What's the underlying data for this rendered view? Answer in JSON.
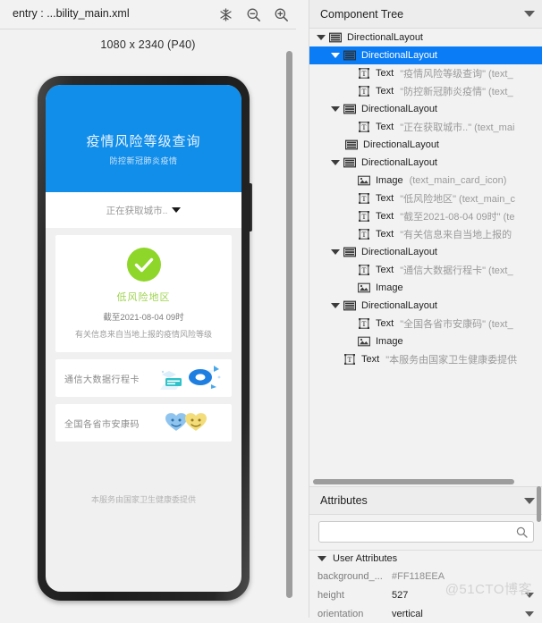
{
  "toolbar": {
    "title": "entry : ...bility_main.xml",
    "icons": [
      {
        "name": "snowflake-icon"
      },
      {
        "name": "zoom-out-icon"
      },
      {
        "name": "zoom-in-icon"
      }
    ]
  },
  "canvas": {
    "device_label": "1080 x 2340 (P40)"
  },
  "preview": {
    "header_title": "疫情风险等级查询",
    "header_subtitle": "防控新冠肺炎疫情",
    "city_selector": "正在获取城市..",
    "risk_level": "低风险地区",
    "risk_time": "截至2021-08-04 09时",
    "risk_note": "有关信息来自当地上报的疫情风险等级",
    "link_cards": [
      {
        "label": "通信大数据行程卡",
        "art": "travel-card-illustration"
      },
      {
        "label": "全国各省市安康码",
        "art": "health-code-illustration"
      }
    ],
    "footer": "本服务由国家卫生健康委提供"
  },
  "component_tree": {
    "title": "Component Tree",
    "rows": [
      {
        "indent": 0,
        "arrow": "down",
        "icon": "layout",
        "name": "DirectionalLayout",
        "value": "",
        "selected": false
      },
      {
        "indent": 1,
        "arrow": "down",
        "icon": "layout",
        "name": "DirectionalLayout",
        "value": "",
        "selected": true
      },
      {
        "indent": 2,
        "arrow": "none",
        "icon": "text",
        "name": "Text",
        "value": "\"疫情风险等级查询\" (text_",
        "selected": false
      },
      {
        "indent": 2,
        "arrow": "none",
        "icon": "text",
        "name": "Text",
        "value": "\"防控新冠肺炎疫情\" (text_",
        "selected": false
      },
      {
        "indent": 1,
        "arrow": "down",
        "icon": "layout",
        "name": "DirectionalLayout",
        "value": "",
        "selected": false
      },
      {
        "indent": 2,
        "arrow": "none",
        "icon": "text",
        "name": "Text",
        "value": "\"正在获取城市..\" (text_mai",
        "selected": false
      },
      {
        "indent": 2,
        "arrow": "right",
        "icon": "layout",
        "name": "DirectionalLayout",
        "value": "",
        "selected": false
      },
      {
        "indent": 1,
        "arrow": "down",
        "icon": "layout",
        "name": "DirectionalLayout",
        "value": "",
        "selected": false
      },
      {
        "indent": 2,
        "arrow": "none",
        "icon": "image",
        "name": "Image",
        "value": "(text_main_card_icon)",
        "selected": false
      },
      {
        "indent": 2,
        "arrow": "none",
        "icon": "text",
        "name": "Text",
        "value": "\"低风险地区\" (text_main_c",
        "selected": false
      },
      {
        "indent": 2,
        "arrow": "none",
        "icon": "text",
        "name": "Text",
        "value": "\"截至2021-08-04 09时\" (te",
        "selected": false
      },
      {
        "indent": 2,
        "arrow": "none",
        "icon": "text",
        "name": "Text",
        "value": "\"有关信息来自当地上报的",
        "selected": false
      },
      {
        "indent": 1,
        "arrow": "down",
        "icon": "layout",
        "name": "DirectionalLayout",
        "value": "",
        "selected": false
      },
      {
        "indent": 2,
        "arrow": "none",
        "icon": "text",
        "name": "Text",
        "value": "\"通信大数据行程卡\" (text_",
        "selected": false
      },
      {
        "indent": 2,
        "arrow": "none",
        "icon": "image",
        "name": "Image",
        "value": "",
        "selected": false
      },
      {
        "indent": 1,
        "arrow": "down",
        "icon": "layout",
        "name": "DirectionalLayout",
        "value": "",
        "selected": false
      },
      {
        "indent": 2,
        "arrow": "none",
        "icon": "text",
        "name": "Text",
        "value": "\"全国各省市安康码\" (text_",
        "selected": false
      },
      {
        "indent": 2,
        "arrow": "none",
        "icon": "image",
        "name": "Image",
        "value": "",
        "selected": false
      },
      {
        "indent": 1,
        "arrow": "none",
        "icon": "text",
        "name": "Text",
        "value": "\"本服务由国家卫生健康委提供",
        "selected": false
      }
    ]
  },
  "attributes": {
    "title": "Attributes",
    "search_value": "",
    "search_placeholder": "",
    "section_label": "User Attributes",
    "rows": [
      {
        "key": "background_...",
        "value": "#FF118EEA",
        "caret": false,
        "dark": false
      },
      {
        "key": "height",
        "value": "527",
        "caret": true,
        "dark": true
      },
      {
        "key": "orientation",
        "value": "vertical",
        "caret": true,
        "dark": true
      }
    ]
  },
  "watermark": "@51CTO博客",
  "colors": {
    "accent_blue": "#118EEA",
    "selection_blue": "#0A7CF5",
    "risk_green": "#8ED629"
  }
}
